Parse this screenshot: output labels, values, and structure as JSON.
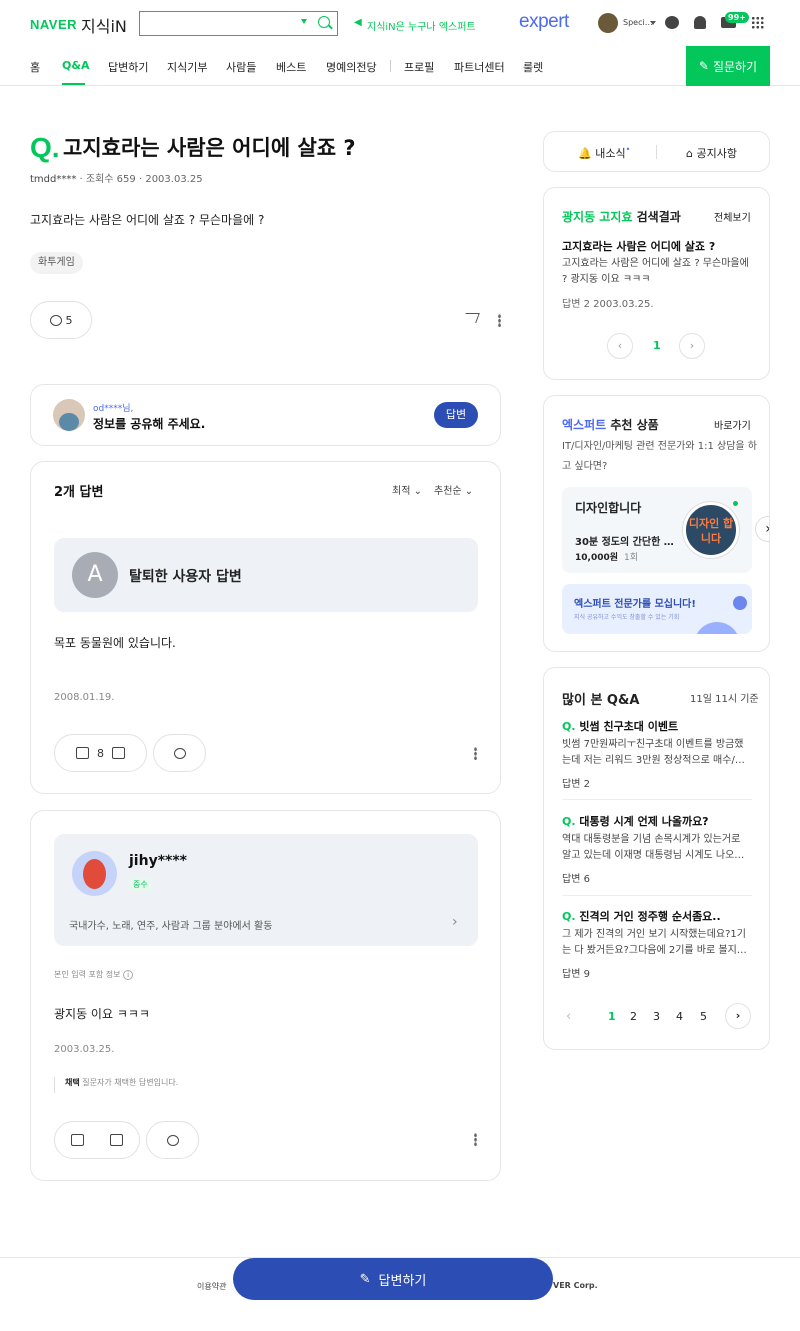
{
  "header": {
    "logo_naver": "NAVER",
    "logo_kin": "지식iN",
    "search": {
      "value": "",
      "placeholder": ""
    },
    "notice_link": "지식iN은 누구나 엑스퍼트",
    "expert_logo": "expert",
    "user_name": "Speci…",
    "mail_badge": "99+"
  },
  "nav": {
    "items": [
      "홈",
      "Q&A",
      "답변하기",
      "지식기부",
      "사람들",
      "베스트",
      "명예의전당",
      "프로필",
      "파트너센터",
      "룰렛"
    ],
    "active": "Q&A",
    "ask_button": "질문하기"
  },
  "question": {
    "q_mark": "Q.",
    "title": "고지효라는 사람은 어디에 살죠 ?",
    "author": "tmdd****",
    "views": "조회수 659",
    "date": "2003.03.25",
    "body": "고지효라는 사람은 어디에 살죠 ? 무슨마을에 ?",
    "tag": "화투게임",
    "comment_count": "5"
  },
  "share_card": {
    "user": "od****님,",
    "message": "정보를 공유해 주세요.",
    "answer_button": "답변"
  },
  "answers": {
    "count_label": "2개 답변",
    "sort_latest": "최적",
    "sort_recommend": "추천순",
    "list": [
      {
        "avatar_letter": "A",
        "author": "탈퇴한 사용자 답변",
        "content": "목포 동물원에 있습니다.",
        "date": "2008.01.19.",
        "likes": "8"
      },
      {
        "author": "jihy****",
        "rank": "중수",
        "activity": "국내가수, 노래, 연주, 사람과 그룹 분야에서 활동",
        "info_note": "본인 입력 포함 정보",
        "content": "광지동 이요 ㅋㅋㅋ",
        "date": "2003.03.25.",
        "adopt_label": "채택",
        "adopt_text": "질문자가 채택한 답변입니다."
      }
    ]
  },
  "sidebar": {
    "news_button": "내소식",
    "notice_button": "공지사항",
    "search_result": {
      "keyword": "광지동 고지효",
      "suffix": "검색결과",
      "view_all": "전체보기",
      "item_title": "고지효라는 사람은 어디에 살죠 ?",
      "item_desc": "고지효라는 사람은 어디에 살죠 ? 무슨마을에 ? 광지동 이요 ㅋㅋㅋ",
      "item_meta_answers": "답변 2",
      "item_meta_date": "2003.03.25.",
      "page": "1"
    },
    "expert": {
      "brand": "엑스퍼트",
      "title": "추천 상품",
      "go": "바로가기",
      "sub": "IT/디자인/마케팅 관련 전문가와 1:1 상담을 하고 싶다면?",
      "product_title": "디자인합니다",
      "product_desc": "30분 정도의 간단한 …",
      "product_price": "10,000원",
      "product_count": "1회",
      "product_badge": "디자인 합니다",
      "banner_title": "엑스퍼트 전문가를 모십니다!",
      "banner_sub": "지식 공유하고 수익도 창출할 수 있는 기회"
    },
    "popular": {
      "title": "많이 본 Q&A",
      "time": "11일 11시 기준",
      "items": [
        {
          "title": "빗썸 친구초대 이벤트",
          "desc": "빗썸 7만원짜리ㅜ친구초대 이벤트를 방금했는데 저는 리워드 3만원 정상적으로 매수/…",
          "answers": "답변 2"
        },
        {
          "title": "대통령 시계 언제 나올까요?",
          "desc": "역대 대통령분을 기념 손목시계가 있는거로 알고 있는데 이재명 대통령님 시계도 나오…",
          "answers": "답변 6"
        },
        {
          "title": "진격의 거인 정주행 순서좀요..",
          "desc": "그 제가 진격의 거인 보기 시작했는데요?1기는 다 봤거든요?그다음에 2기를 바로 볼지…",
          "answers": "답변 9"
        }
      ],
      "pages": [
        "1",
        "2",
        "3",
        "4",
        "5"
      ],
      "current_page": "1"
    }
  },
  "footer": {
    "terms": "이용약관",
    "corp": "VER Corp.",
    "answer_fab": "답변하기"
  },
  "colors": {
    "brand_green": "#03c75a",
    "expert_blue": "#2c4db3"
  }
}
